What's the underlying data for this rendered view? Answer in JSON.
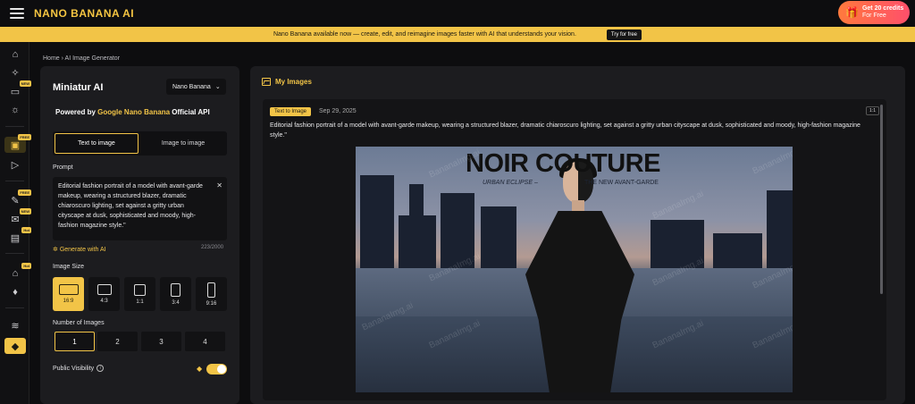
{
  "app": {
    "logo": "NANO BANANA AI",
    "credits_line1": "Get 20 credits",
    "credits_line2": "For Free"
  },
  "banner": {
    "message": "Nano Banana available now — create, edit, and reimagine images faster with AI that understands your vision.",
    "cta": "Try for free"
  },
  "sidebar": {
    "items": [
      {
        "icon": "home-icon"
      },
      {
        "icon": "sparkles-icon"
      },
      {
        "icon": "chat-icon",
        "badge": "NEW"
      },
      {
        "icon": "lightbulb-icon"
      },
      {
        "icon": "image-generator-icon",
        "badge": "FREE",
        "active": true
      },
      {
        "icon": "video-icon"
      },
      {
        "icon": "magic-wand-icon",
        "badge": "FREE"
      },
      {
        "icon": "mail-icon",
        "badge": "NEW"
      },
      {
        "icon": "film-icon",
        "badge": "Hot"
      },
      {
        "icon": "shirt-icon",
        "badge": "Hot"
      },
      {
        "icon": "microphone-icon"
      },
      {
        "icon": "layers-icon"
      },
      {
        "icon": "diamond-icon"
      }
    ]
  },
  "breadcrumb": {
    "home": "Home",
    "separator": "›",
    "current": "AI Image Generator"
  },
  "generator": {
    "title": "Miniatur AI",
    "model": "Nano Banana",
    "powered_prefix": "Powered by",
    "powered_highlight": "Google Nano Banana",
    "powered_suffix": "Official API",
    "tabs": [
      "Text to image",
      "Image to image"
    ],
    "prompt_label": "Prompt",
    "prompt_text": "Editorial fashion portrait of a model with avant-garde makeup, wearing a structured blazer, dramatic chiaroscuro lighting, set against a gritty urban cityscape at dusk, sophisticated and moody, high-fashion magazine style.\"",
    "generate_with_ai": "Generate with AI",
    "counter": "223/2000",
    "image_size_label": "Image Size",
    "sizes": [
      "16:9",
      "4:3",
      "1:1",
      "3:4",
      "9:16"
    ],
    "selected_size": "16:9",
    "number_label": "Number of Images",
    "numbers": [
      "1",
      "2",
      "3",
      "4"
    ],
    "selected_number": "1",
    "visibility_label": "Public Visibility",
    "visibility_on": true
  },
  "my_images": {
    "heading": "My Images",
    "card": {
      "tag": "Text to Image",
      "date": "Sep 29, 2025",
      "ratio": "1:1",
      "description": "Editorial fashion portrait of a model with avant-garde makeup, wearing a structured blazer, dramatic chiaroscuro lighting, set against a gritty urban cityscape at dusk, sophisticated and moody, high-fashion magazine style.\"",
      "image_title": "NOIR COUTURE",
      "image_sub_left": "URBAN ECLIPSE –",
      "image_sub_right": "THE NEW AVANT-GARDE",
      "watermark": "BananaImg.ai"
    }
  },
  "colors": {
    "accent": "#f2c447",
    "background": "#0d0d0f",
    "panel": "#1c1c1f"
  }
}
